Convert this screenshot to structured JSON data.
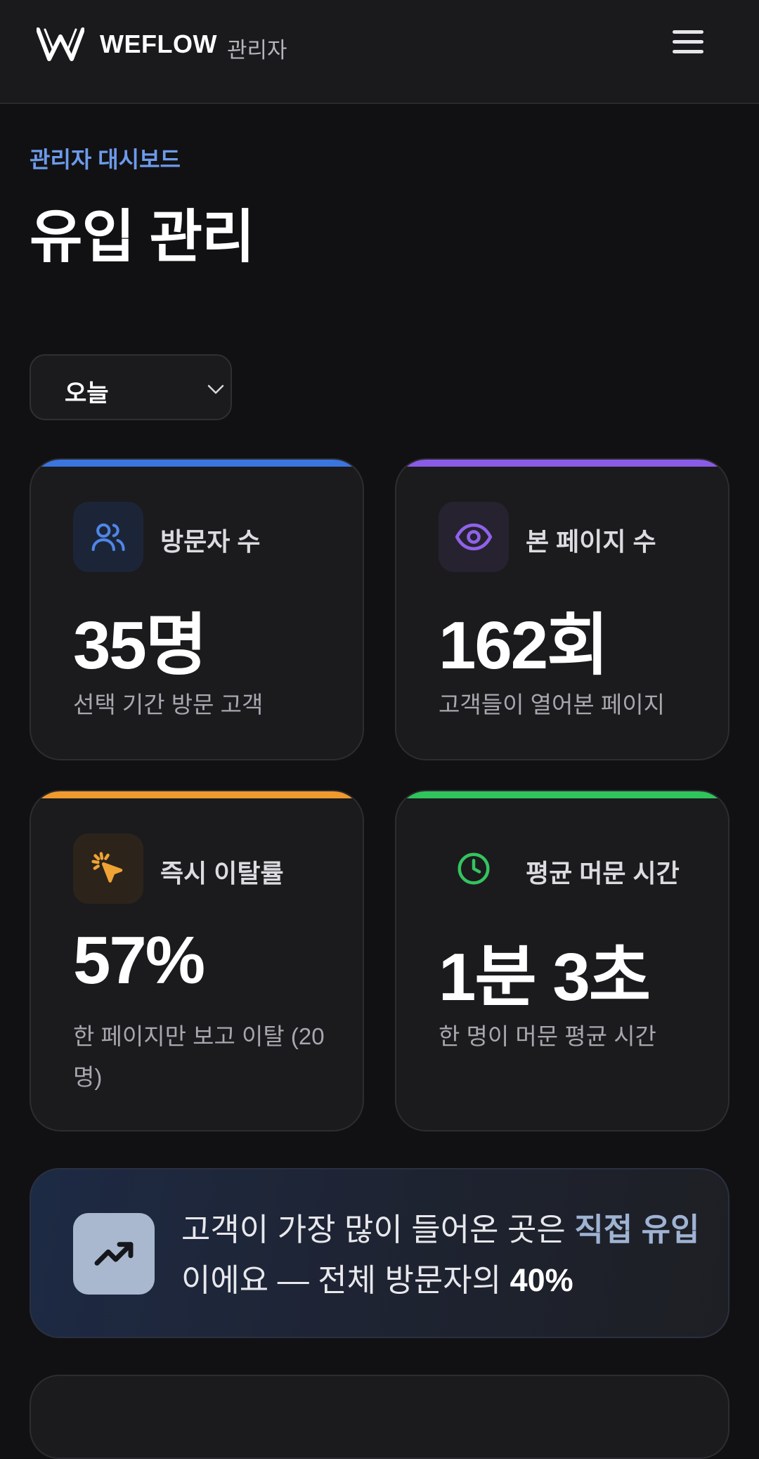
{
  "header": {
    "brand": "WEFLOW",
    "brand_sub": "관리자",
    "logo_icon": "weflow-w-logo",
    "menu_icon": "hamburger-menu-icon"
  },
  "page": {
    "breadcrumb": "관리자 대시보드",
    "title": "유입 관리"
  },
  "period_select": {
    "value": "오늘",
    "icon": "chevron-down-icon"
  },
  "stats": [
    {
      "label": "방문자 수",
      "value": "35명",
      "desc": "선택 기간 방문 고객",
      "icon": "users-icon",
      "accent": "#3b76e0",
      "icon_bg": "#1c2538",
      "icon_color": "#4f86e8"
    },
    {
      "label": "본 페이지 수",
      "value": "162회",
      "desc": "고객들이 열어본 페이지",
      "icon": "eye-icon",
      "accent": "#8a5be6",
      "icon_bg": "#27222f",
      "icon_color": "#8f62ea"
    },
    {
      "label": "즉시 이탈률",
      "value": "57%",
      "desc": "한 페이지만 보고 이탈 (20명)",
      "icon": "cursor-click-icon",
      "accent": "#f09a2e",
      "icon_bg": "#2c241b",
      "icon_color": "#f0a235"
    },
    {
      "label": "평균 머문 시간",
      "value": "1분 3초",
      "desc": "한 명이 머문 평균 시간",
      "icon": "clock-icon",
      "accent": "#2fc45c",
      "icon_bg": "#1b1b1e",
      "icon_color": "#34c45e"
    }
  ],
  "insight": {
    "icon": "trending-up-icon",
    "text_before": "고객이 가장 많이 들어온 곳은 ",
    "highlight": "직접 유입",
    "text_middle": " 이에요 — 전체 방문자의 ",
    "percent": "40%"
  }
}
